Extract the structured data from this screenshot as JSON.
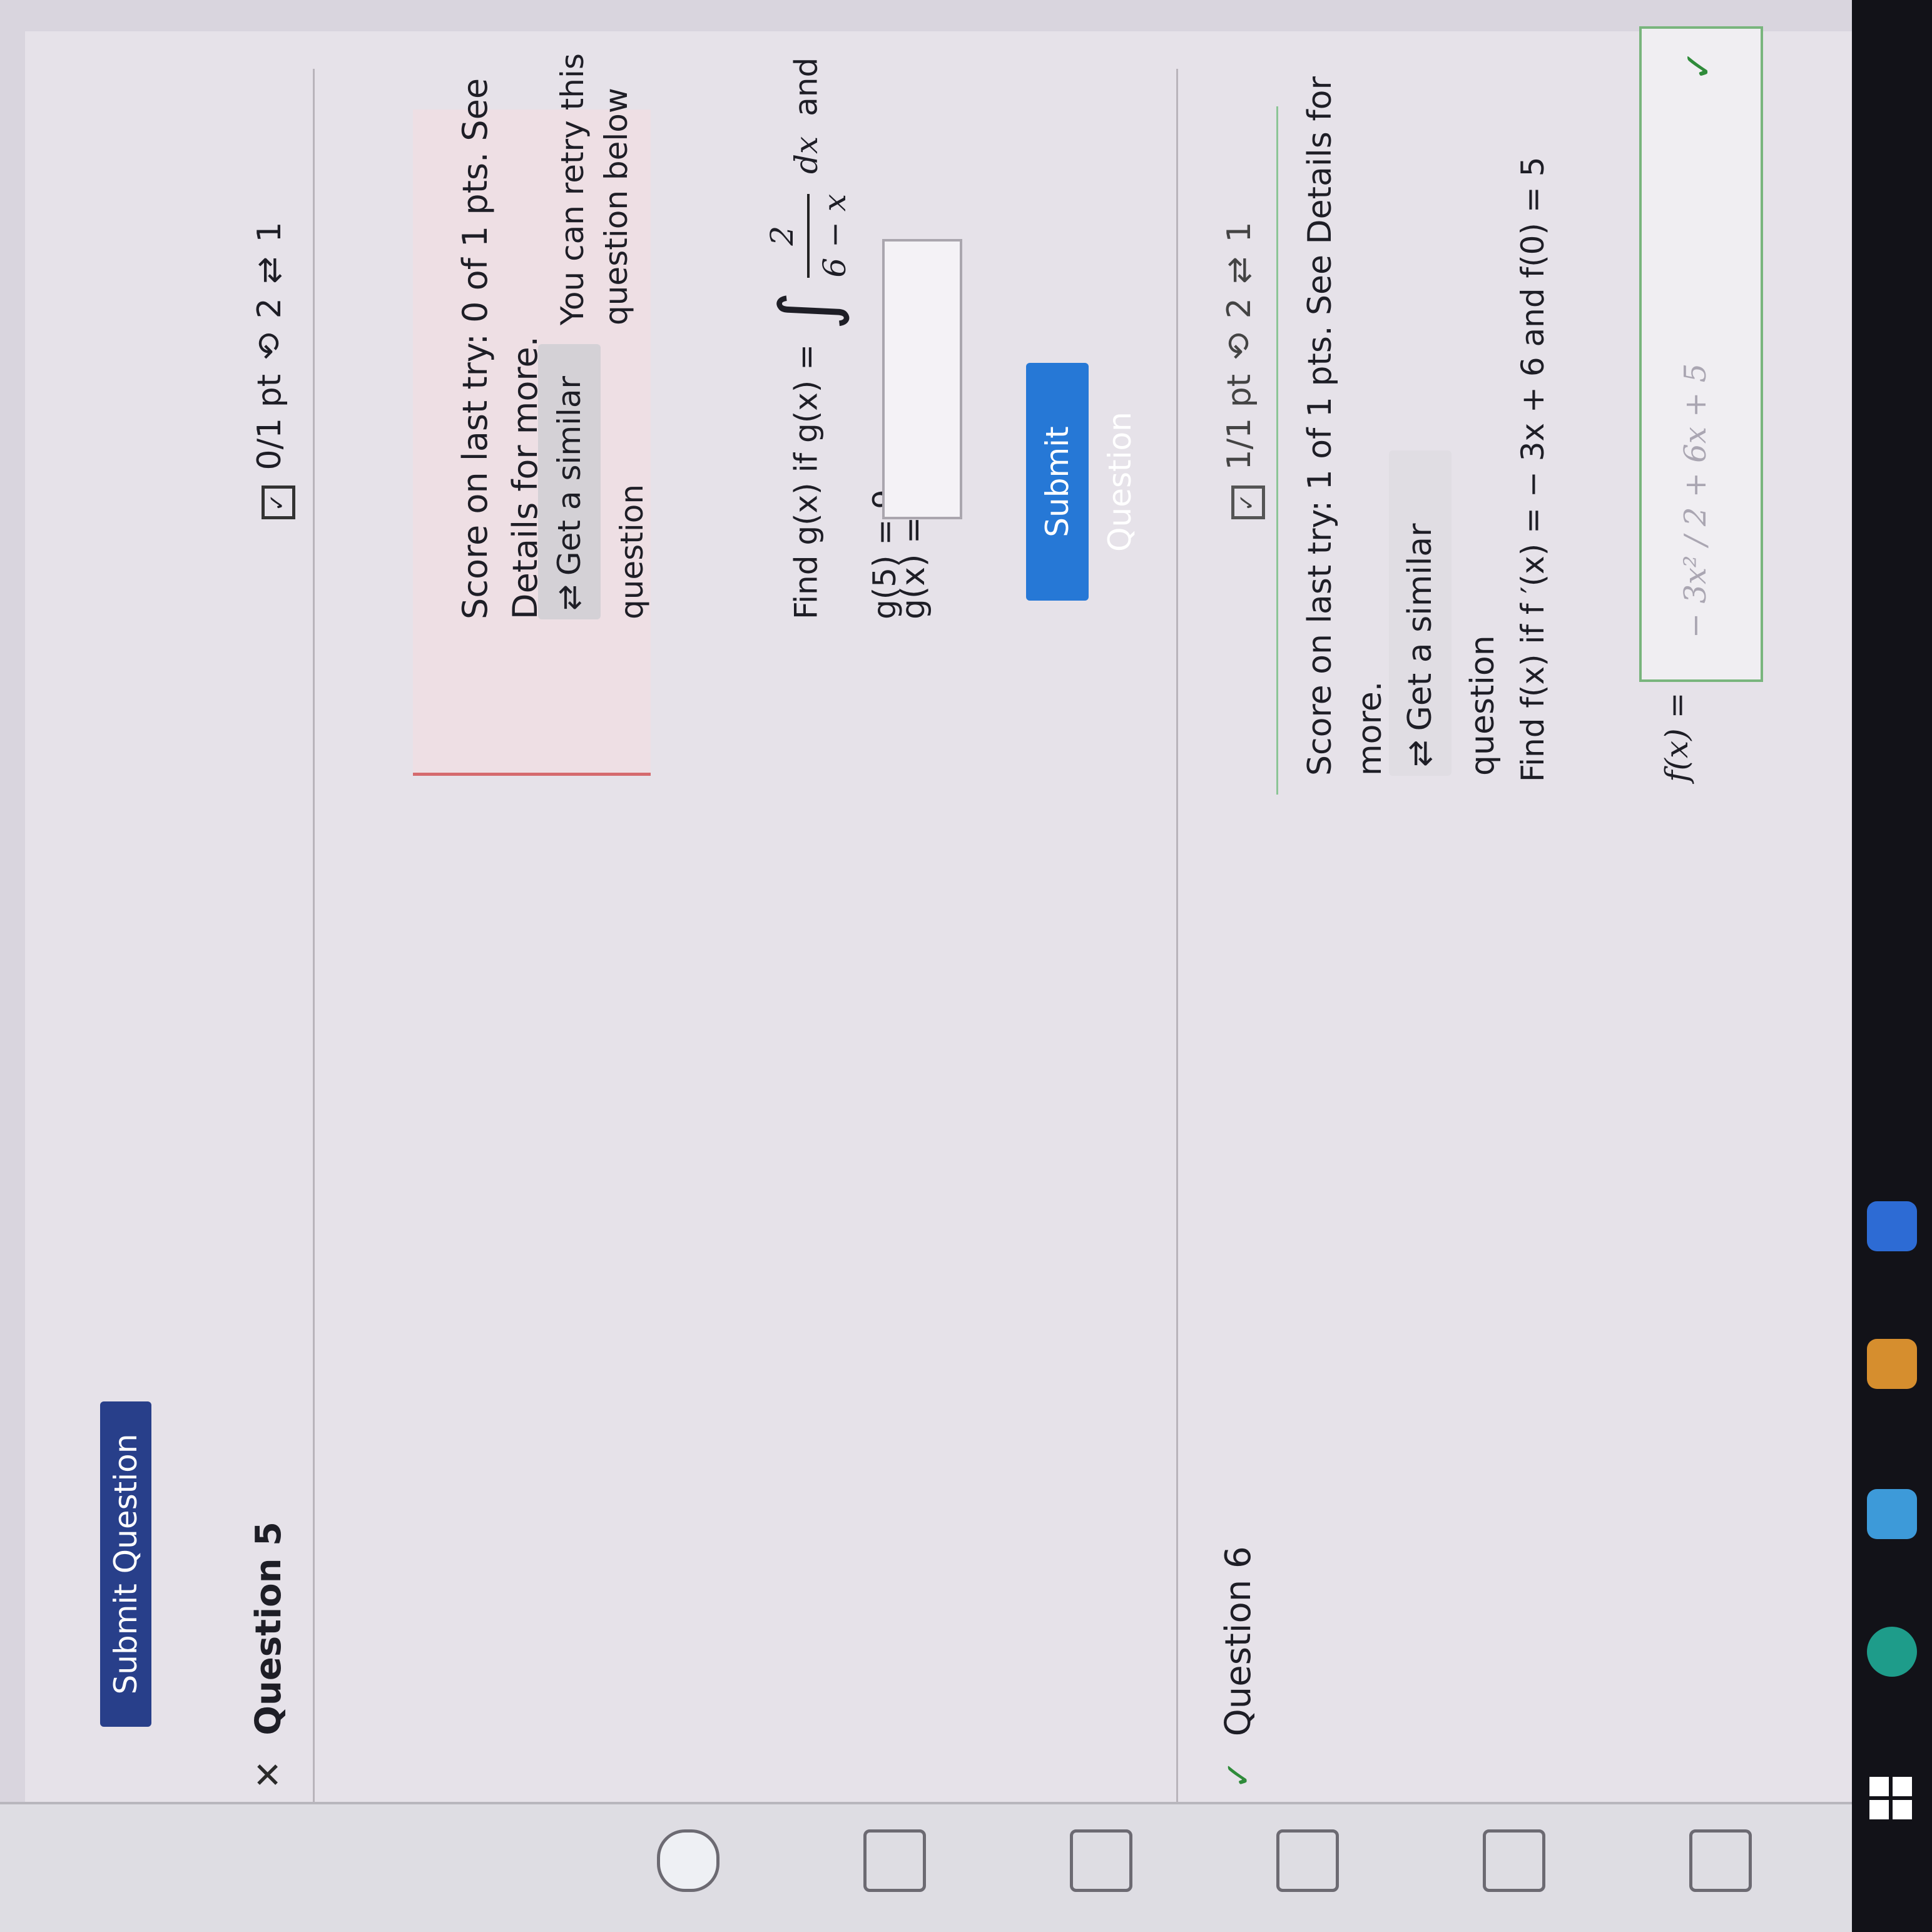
{
  "toolbar": {
    "submit_label": "Submit Question",
    "close_glyph": "×"
  },
  "question5": {
    "status_mark": "✕",
    "title": "Question 5",
    "score_pill": "0/1 pt",
    "retries": "2",
    "similar_count": "1",
    "alert_text": "Score on last try: 0 of 1 pts. See Details for more.",
    "similar_button": "Get a similar question",
    "retry_note": "You can retry this question below",
    "problem_prefix": "Find g(x) if g(x) =",
    "integral_sign": "∫",
    "frac_num": "2",
    "frac_den": "6 − x",
    "dx": "dx",
    "problem_suffix": "and g(5) = 9",
    "answer_label": "g(x) =",
    "answer_value": "",
    "submit_label": "Submit Question"
  },
  "question6": {
    "status_mark": "✓",
    "title": "Question 6",
    "score_pill": "1/1 pt",
    "retries": "2",
    "similar_count": "1",
    "score_text": "Score on last try: 1 of 1 pts. See Details for more.",
    "similar_button": "Get a similar question",
    "problem_text": "Find f(x) if f ′(x) = − 3x + 6 and f(0) = 5",
    "answer_label": "f(x) =",
    "answer_value": "− 3x² / 2 + 6x + 5",
    "answer_status": "✓"
  },
  "colors": {
    "submit_dark": "#283f8a",
    "submit_blue": "#2678d6",
    "alert_bg": "#eedfe4",
    "alert_border": "#d56a6e",
    "correct_green": "#2f8b3a"
  },
  "icons": [
    "close-icon",
    "check-box-icon",
    "retry-icon",
    "similar-icon",
    "start-icon"
  ]
}
